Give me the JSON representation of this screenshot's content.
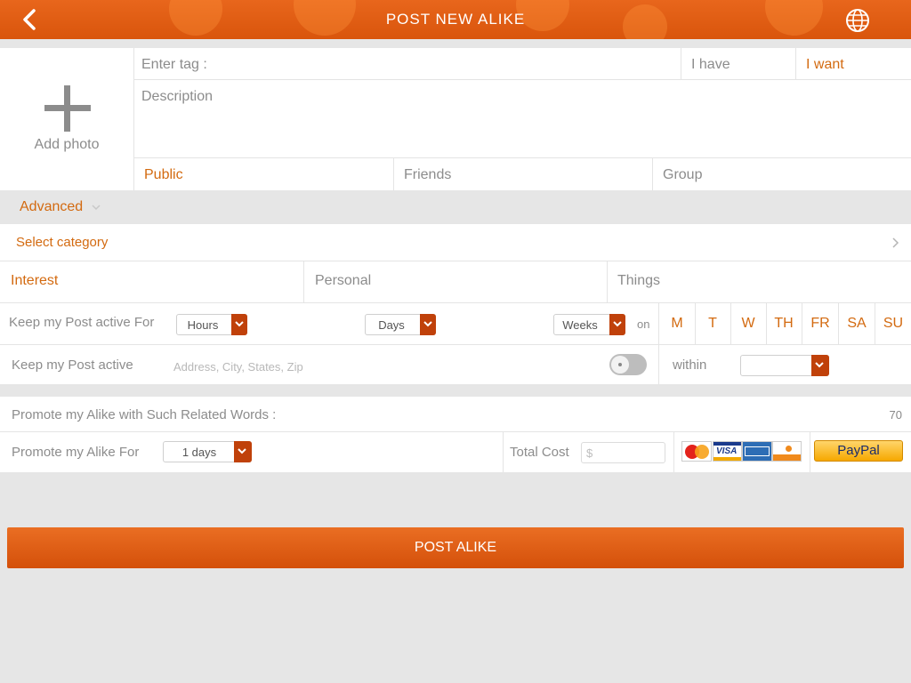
{
  "header": {
    "title": "POST NEW ALIKE",
    "back_icon": "chevron-left-icon",
    "globe_icon": "globe-icon"
  },
  "photo": {
    "label": "Add photo"
  },
  "tag": {
    "placeholder": "Enter tag :",
    "have_label": "I have",
    "want_label": "I want"
  },
  "description": {
    "placeholder": "Description"
  },
  "visibility": {
    "public": "Public",
    "friends": "Friends",
    "group": "Group"
  },
  "advanced": {
    "label": "Advanced"
  },
  "category": {
    "label": "Select category",
    "tabs": [
      "Interest",
      "Personal",
      "Things"
    ]
  },
  "active_for": {
    "label": "Keep my Post active For",
    "hours": "Hours",
    "days": "Days",
    "weeks": "Weeks",
    "on": "on",
    "days_of_week": [
      "M",
      "T",
      "W",
      "TH",
      "FR",
      "SA",
      "SU"
    ]
  },
  "active_location": {
    "label": "Keep my Post active",
    "address_placeholder": "Address, City, States, Zip",
    "within": "within"
  },
  "promote_words": {
    "label": "Promote my Alike with Such Related Words :",
    "count": "70"
  },
  "promote_for": {
    "label": "Promote my Alike For",
    "days_value": "1 days",
    "total_cost_label": "Total Cost",
    "cost_placeholder": "$",
    "paypal": "PayPal",
    "cards": [
      "MasterCard",
      "VISA",
      "AMERICAN EXPRESS",
      "DISCOVER"
    ]
  },
  "post_button": "POST ALIKE",
  "colors": {
    "accent": "#d9550c",
    "orange_text": "#d36a10",
    "select_arrow": "#c0410a"
  }
}
